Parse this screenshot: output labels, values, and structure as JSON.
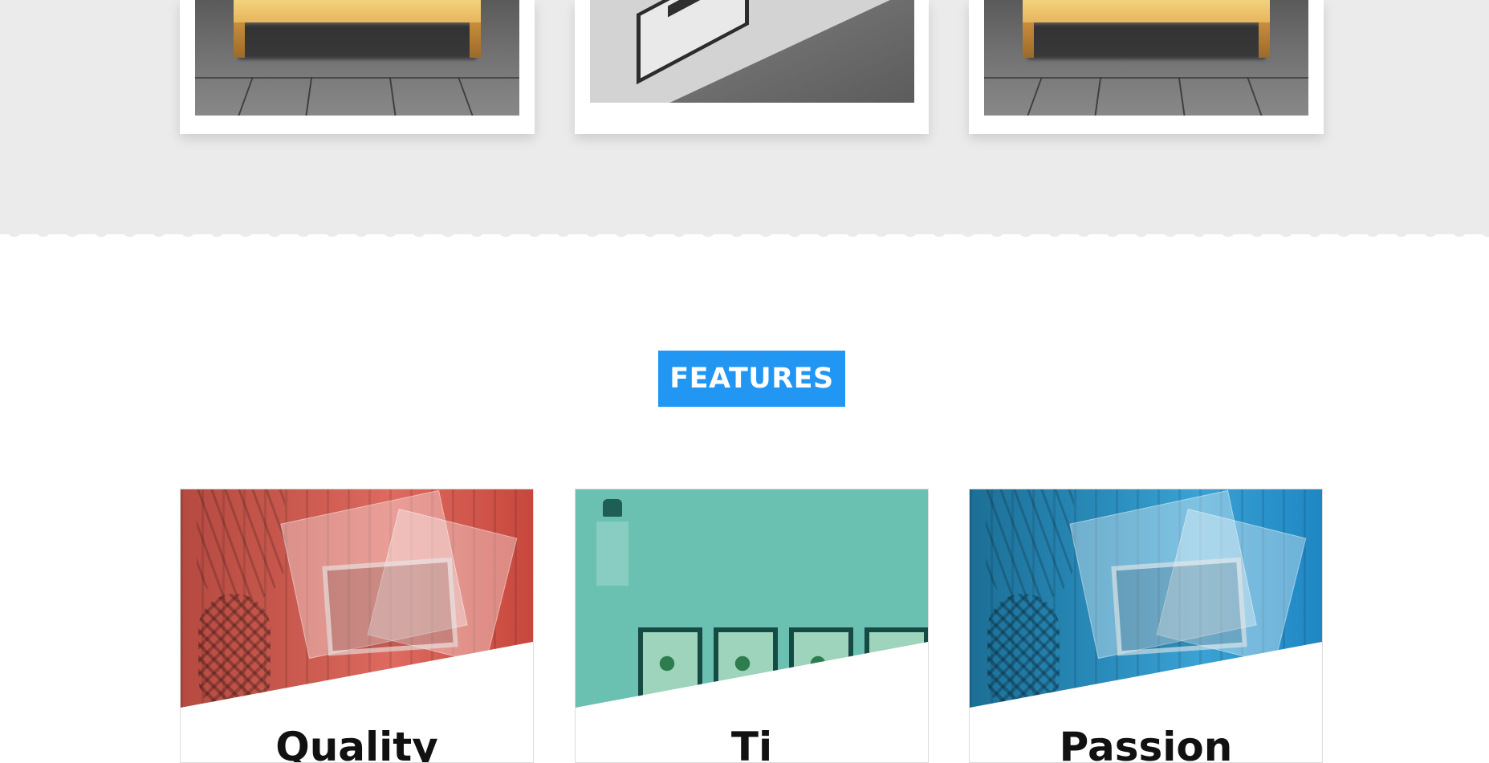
{
  "gallery": {
    "cards": [
      {
        "image": "bench-photo"
      },
      {
        "image": "gallery-wall-photo"
      },
      {
        "image": "bench-photo"
      }
    ],
    "background": "#ebebeb"
  },
  "features": {
    "heading": "FEATURES",
    "accent_color": "#2196f3",
    "cards": [
      {
        "title": "Quality",
        "image": "pineapple-postcards-photo",
        "tint": "#d9574c"
      },
      {
        "title": "Ti",
        "image": "framed-plants-wall-photo",
        "tint": "#5fbcaa"
      },
      {
        "title": "Passion",
        "image": "pineapple-postcards-photo",
        "tint": "#2196d3"
      }
    ]
  }
}
